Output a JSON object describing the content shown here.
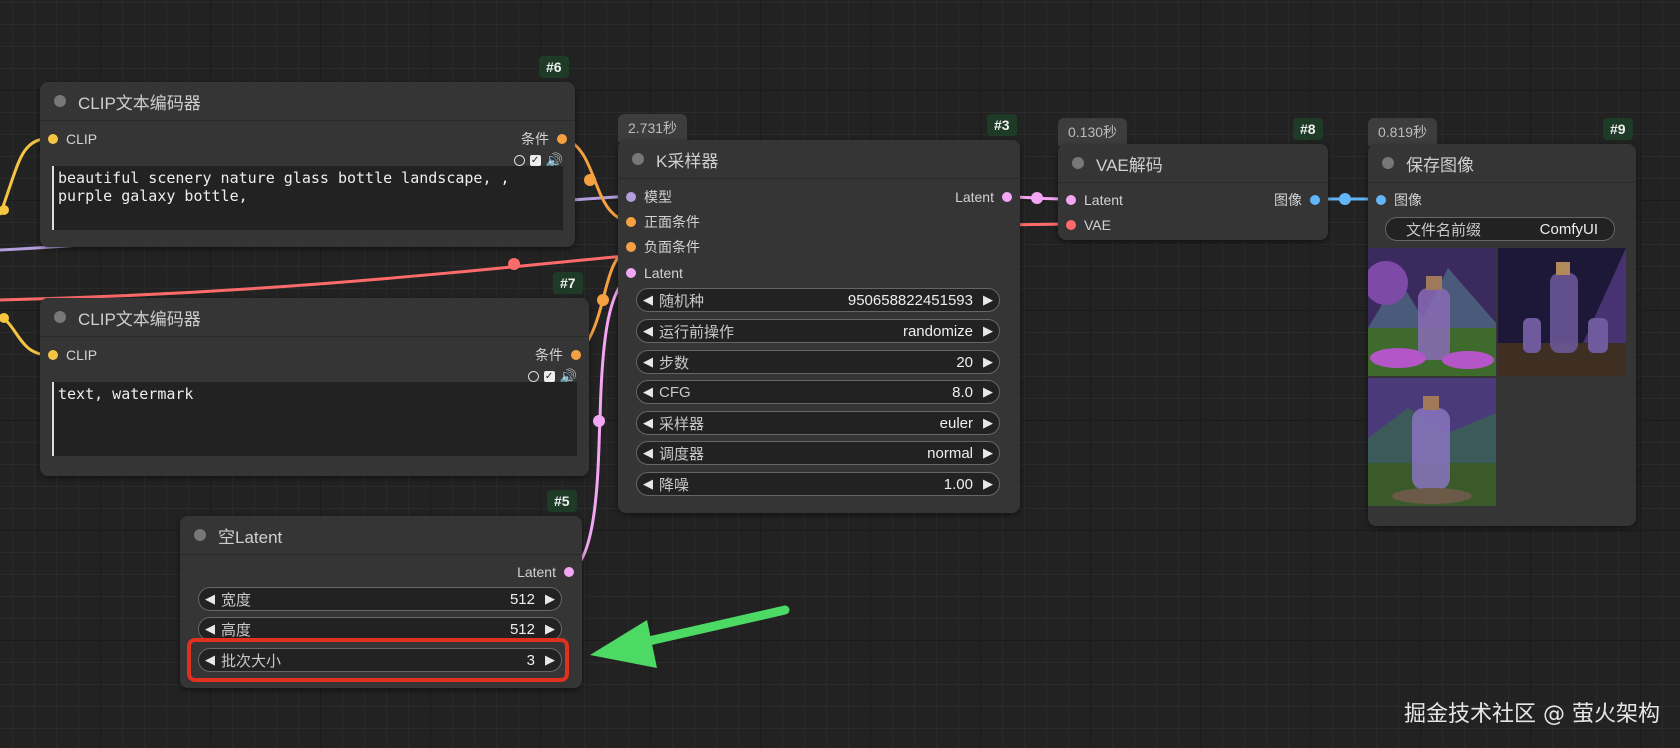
{
  "colors": {
    "clip": "#f5c542",
    "conditioning": "#f5a142",
    "model": "#b39ddb",
    "latent": "#f3a6f3",
    "vae": "#ff6b6b",
    "image": "#64b5f6",
    "highlight": "#e0301e",
    "arrow": "#4cd964"
  },
  "node6": {
    "badge": "#6",
    "title": "CLIP文本编码器",
    "in_clip": "CLIP",
    "out_cond": "条件",
    "text": "beautiful scenery nature glass bottle landscape, ,\npurple galaxy bottle,"
  },
  "node7": {
    "badge": "#7",
    "title": "CLIP文本编码器",
    "in_clip": "CLIP",
    "out_cond": "条件",
    "text": "text, watermark"
  },
  "node5": {
    "badge": "#5",
    "title": "空Latent",
    "out_latent": "Latent",
    "widgets": [
      {
        "label": "宽度",
        "value": "512"
      },
      {
        "label": "高度",
        "value": "512"
      },
      {
        "label": "批次大小",
        "value": "3"
      }
    ]
  },
  "node3": {
    "badge": "#3",
    "time": "2.731秒",
    "title": "K采样器",
    "inputs": [
      "模型",
      "正面条件",
      "负面条件",
      "Latent"
    ],
    "out_latent": "Latent",
    "widgets": [
      {
        "label": "随机种",
        "value": "950658822451593"
      },
      {
        "label": "运行前操作",
        "value": "randomize"
      },
      {
        "label": "步数",
        "value": "20"
      },
      {
        "label": "CFG",
        "value": "8.0"
      },
      {
        "label": "采样器",
        "value": "euler"
      },
      {
        "label": "调度器",
        "value": "normal"
      },
      {
        "label": "降噪",
        "value": "1.00"
      }
    ]
  },
  "node8": {
    "badge": "#8",
    "time": "0.130秒",
    "title": "VAE解码",
    "in_latent": "Latent",
    "in_vae": "VAE",
    "out_image": "图像"
  },
  "node9": {
    "badge": "#9",
    "time": "0.819秒",
    "title": "保存图像",
    "in_image": "图像",
    "prefix_label": "文件名前缀",
    "prefix_value": "ComfyUI",
    "thumbnails": [
      "bottle-landscape-1",
      "bottle-landscape-2",
      "bottle-landscape-3"
    ]
  },
  "watermark": "掘金技术社区 @ 萤火架构"
}
